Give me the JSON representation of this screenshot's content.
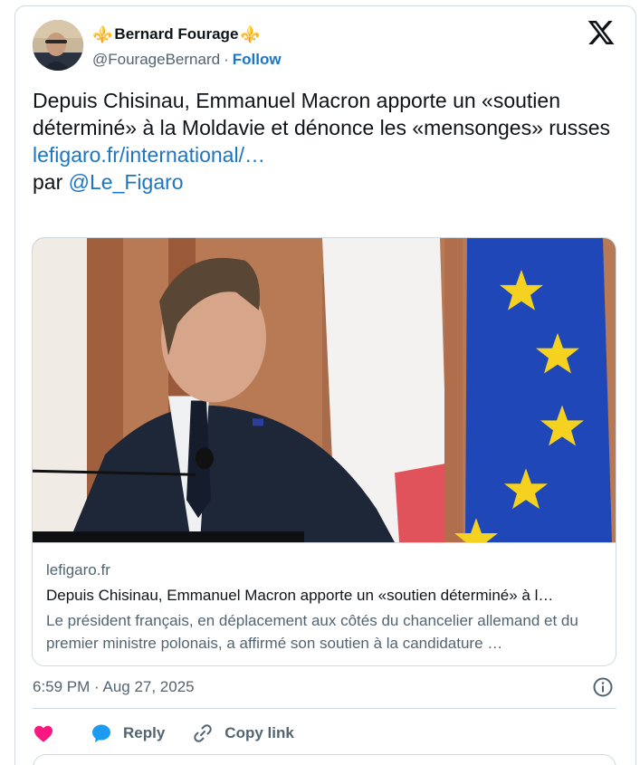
{
  "author": {
    "display_name": "Bernard Fourage",
    "prefix_glyph": "⚜️",
    "suffix_glyph": "⚜️",
    "handle": "@FourageBernard",
    "separator": "·",
    "follow_label": "Follow"
  },
  "tweet": {
    "text": "Depuis Chisinau, Emmanuel Macron apporte un «soutien déterminé» à la Moldavie et dénonce les «mensonges» russes",
    "link_text": "lefigaro.fr/international/…",
    "par_prefix": "par",
    "mention": "@Le_Figaro"
  },
  "link_card": {
    "domain": "lefigaro.fr",
    "title": "Depuis Chisinau, Emmanuel Macron apporte un «soutien déterminé» à l…",
    "description": "Le président français, en déplacement aux côtés du chancelier allemand et du premier ministre polonais, a affirmé son soutien à la candidature …"
  },
  "meta": {
    "timestamp": "6:59 PM · Aug 27, 2025"
  },
  "actions": {
    "reply_label": "Reply",
    "copy_link_label": "Copy link"
  },
  "icons": {
    "like": "heart-icon",
    "reply": "speech-bubble-icon",
    "copy": "link-icon",
    "info": "info-icon",
    "brand": "x-logo-icon"
  },
  "colors": {
    "accent": "#1d75c2",
    "like": "#f91880",
    "reply": "#1d9bf0",
    "secondary_text": "#536471",
    "border": "#cfd9de",
    "fleur": "#8a5bd6"
  }
}
